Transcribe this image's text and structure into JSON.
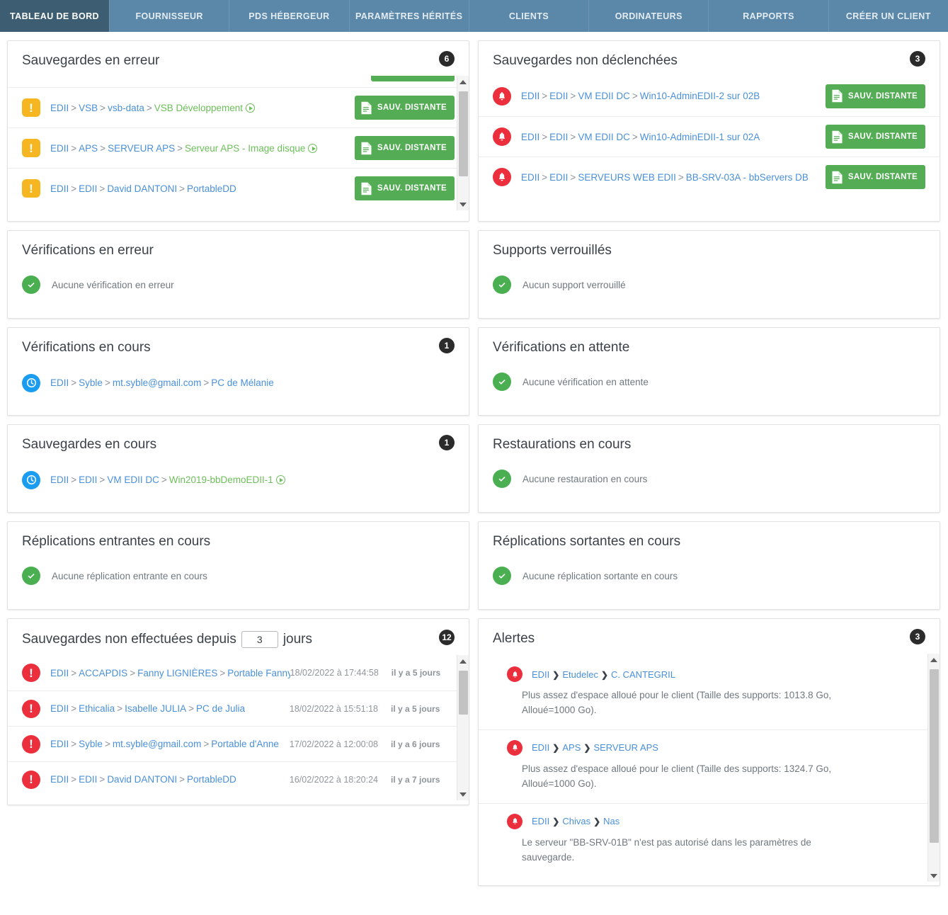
{
  "nav": {
    "tabs": [
      {
        "label": "TABLEAU DE BORD",
        "active": true
      },
      {
        "label": "FOURNISSEUR",
        "active": false
      },
      {
        "label": "PDS HÉBERGEUR",
        "active": false
      },
      {
        "label": "PARAMÈTRES HÉRITÉS",
        "active": false
      },
      {
        "label": "CLIENTS",
        "active": false
      },
      {
        "label": "ORDINATEURS",
        "active": false
      },
      {
        "label": "RAPPORTS",
        "active": false
      },
      {
        "label": "CRÉER UN CLIENT",
        "active": false
      }
    ]
  },
  "buttons": {
    "remote_backup": "SAUV. DISTANTE"
  },
  "colors": {
    "nav_bg": "#5b87a8",
    "nav_active_bg": "#3d5d73",
    "link": "#4a90d9",
    "green": "#54ac55",
    "warn": "#f6b622",
    "error": "#ec2f3c",
    "ok": "#49af50",
    "info": "#1a9cf0",
    "badge_bg": "#2b2b2b"
  },
  "panels": {
    "backups_error": {
      "title": "Sauvegardes en erreur",
      "count": "6",
      "rows": [
        {
          "crumbs": [
            "EDII",
            "VSB",
            "vsb-data"
          ],
          "leaf": "VSB Développement",
          "leaf_green": true,
          "has_play": true,
          "button": "SAUV. DISTANTE"
        },
        {
          "crumbs": [
            "EDII",
            "APS",
            "SERVEUR APS"
          ],
          "leaf": "Serveur APS - Image disque",
          "leaf_green": true,
          "has_play": true,
          "button": "SAUV. DISTANTE"
        },
        {
          "crumbs": [
            "EDII",
            "EDII",
            "David DANTONI"
          ],
          "leaf": "PortableDD",
          "leaf_green": false,
          "has_play": false,
          "button": "SAUV. DISTANTE"
        }
      ]
    },
    "backups_not_triggered": {
      "title": "Sauvegardes non déclenchées",
      "count": "3",
      "rows": [
        {
          "crumbs": [
            "EDII",
            "EDII",
            "VM EDII DC"
          ],
          "leaf": "Win10-AdminEDII-2 sur 02B",
          "leaf_green": false,
          "has_play": false,
          "button": "SAUV. DISTANTE"
        },
        {
          "crumbs": [
            "EDII",
            "EDII",
            "VM EDII DC"
          ],
          "leaf": "Win10-AdminEDII-1 sur 02A",
          "leaf_green": false,
          "has_play": false,
          "button": "SAUV. DISTANTE"
        },
        {
          "crumbs": [
            "EDII",
            "EDII",
            "SERVEURS WEB EDII"
          ],
          "leaf": "BB-SRV-03A - bbServers DB",
          "leaf_green": false,
          "has_play": false,
          "button": "SAUV. DISTANTE"
        }
      ]
    },
    "verifications_error": {
      "title": "Vérifications en erreur",
      "empty_message": "Aucune vérification en erreur"
    },
    "locked_media": {
      "title": "Supports verrouillés",
      "empty_message": "Aucun support verrouillé"
    },
    "verifications_running": {
      "title": "Vérifications en cours",
      "count": "1",
      "rows": [
        {
          "crumbs": [
            "EDII",
            "Syble",
            "mt.syble@gmail.com"
          ],
          "leaf": "PC de Mélanie",
          "leaf_green": false,
          "has_play": false
        }
      ]
    },
    "verifications_pending": {
      "title": "Vérifications en attente",
      "empty_message": "Aucune vérification en attente"
    },
    "backups_running": {
      "title": "Sauvegardes en cours",
      "count": "1",
      "rows": [
        {
          "crumbs": [
            "EDII",
            "EDII",
            "VM EDII DC"
          ],
          "leaf": "Win2019-bbDemoEDII-1",
          "leaf_green": true,
          "has_play": true
        }
      ]
    },
    "restorations_running": {
      "title": "Restaurations en cours",
      "empty_message": "Aucune restauration en cours"
    },
    "replications_in": {
      "title": "Réplications entrantes en cours",
      "empty_message": "Aucune réplication entrante en cours"
    },
    "replications_out": {
      "title": "Réplications sortantes en cours",
      "empty_message": "Aucune réplication sortante en cours"
    },
    "backups_stale": {
      "title_prefix": "Sauvegardes non effectuées depuis",
      "days_value": "3",
      "title_suffix": "jours",
      "count": "12",
      "rows": [
        {
          "crumbs": [
            "EDII",
            "ACCAPDIS",
            "Fanny LIGNIÈRES"
          ],
          "leaf": "Portable Fanny",
          "date": "18/02/2022 à 17:44:58",
          "ago": "il y a 5 jours"
        },
        {
          "crumbs": [
            "EDII",
            "Ethicalia",
            "Isabelle JULIA"
          ],
          "leaf": "PC de Julia",
          "date": "18/02/2022 à 15:51:18",
          "ago": "il y a 5 jours"
        },
        {
          "crumbs": [
            "EDII",
            "Syble",
            "mt.syble@gmail.com"
          ],
          "leaf": "Portable d'Anne",
          "date": "17/02/2022 à 12:00:08",
          "ago": "il y a 6 jours"
        },
        {
          "crumbs": [
            "EDII",
            "EDII",
            "David DANTONI"
          ],
          "leaf": "PortableDD",
          "date": "16/02/2022 à 18:20:24",
          "ago": "il y a 7 jours"
        }
      ]
    },
    "alerts": {
      "title": "Alertes",
      "count": "3",
      "items": [
        {
          "crumbs": [
            "EDII",
            "Etudelec",
            "C. CANTEGRIL"
          ],
          "message": "Plus assez d'espace alloué pour le client (Taille des supports: 1013.8 Go, Alloué=1000 Go)."
        },
        {
          "crumbs": [
            "EDII",
            "APS",
            "SERVEUR APS"
          ],
          "message": "Plus assez d'espace alloué pour le client (Taille des supports: 1324.7 Go, Alloué=1000 Go)."
        },
        {
          "crumbs": [
            "EDII",
            "Chivas",
            "Nas"
          ],
          "message": "Le serveur \"BB-SRV-01B\" n'est pas autorisé dans les paramètres de sauvegarde."
        }
      ]
    }
  }
}
